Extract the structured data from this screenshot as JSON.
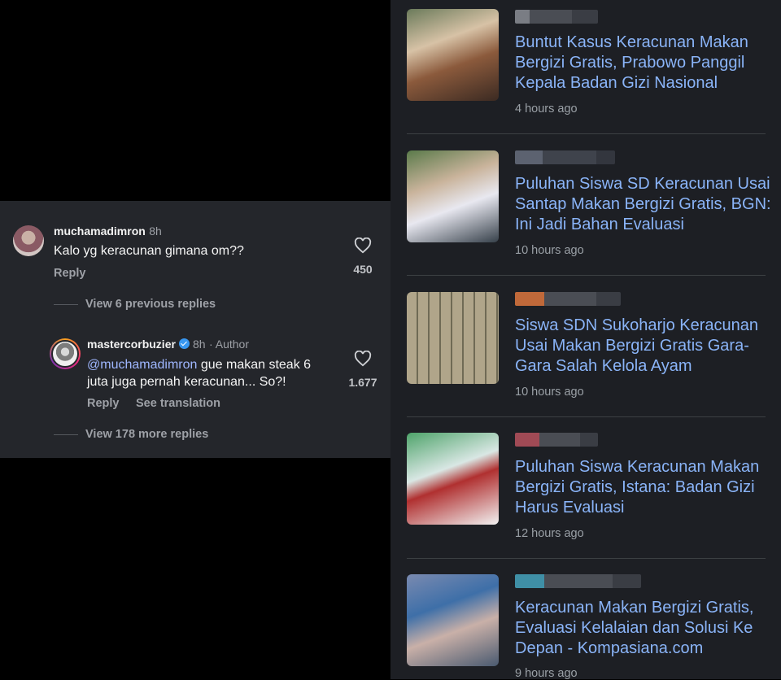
{
  "comments": {
    "comment1": {
      "username": "muchamadimron",
      "time": "8h",
      "text": "Kalo yg keracunan gimana om??",
      "reply_label": "Reply",
      "likes": "450"
    },
    "view_previous": "View 6 previous replies",
    "reply1": {
      "username": "mastercorbuzier",
      "time": "8h",
      "author_label": "· Author",
      "mention": "@muchamadimron",
      "text_line1": " gue makan steak 6",
      "text_line2": "juta juga pernah keracunan... So?!",
      "reply_label": "Reply",
      "translate_label": "See translation",
      "likes": "1.677"
    },
    "view_more": "View 178 more replies"
  },
  "news": {
    "items": [
      {
        "title": "Buntut Kasus Keracunan Makan Bergizi Gratis, Prabowo Panggil Kepala Badan Gizi Nasional",
        "time": "4 hours ago",
        "source_color": "#6b6e75"
      },
      {
        "title": "Puluhan Siswa SD Keracunan Usai Santap Makan Bergizi Gratis, BGN: Ini Jadi Bahan Evaluasi",
        "time": "10 hours ago",
        "source_color": "#5c6270"
      },
      {
        "title": "Siswa SDN Sukoharjo Keracunan Usai Makan Bergizi Gratis Gara-Gara Salah Kelola Ayam",
        "time": "10 hours ago",
        "source_color": "#c0693a"
      },
      {
        "title": "Puluhan Siswa Keracunan Makan Bergizi Gratis, Istana: Badan Gizi Harus Evaluasi",
        "time": "12 hours ago",
        "source_color": "#a04a55"
      },
      {
        "title": "Keracunan Makan Bergizi Gratis, Evaluasi Kelalaian dan Solusi Ke Depan - Kompasiana.com",
        "time": "9 hours ago",
        "source_color": "#3f8fa6"
      }
    ]
  }
}
